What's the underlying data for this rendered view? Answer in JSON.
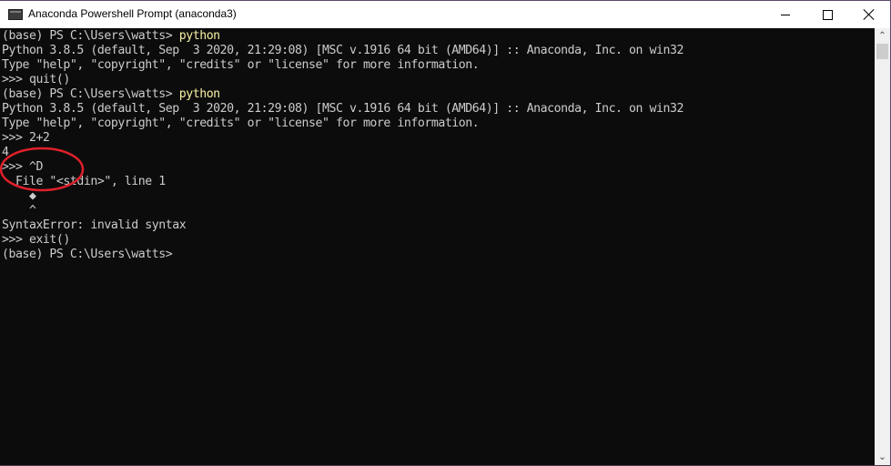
{
  "window": {
    "title": "Anaconda Powershell Prompt (anaconda3)",
    "controls": {
      "minimize": "minimize",
      "maximize": "maximize",
      "close": "close"
    }
  },
  "colors": {
    "terminal_bg": "#0c0c0c",
    "text": "#cccccc",
    "command": "#f9f1a5",
    "annotation": "#e0202a"
  },
  "terminal": {
    "lines": [
      {
        "prefix": "(base) PS C:\\Users\\watts> ",
        "command": "python"
      },
      {
        "text": "Python 3.8.5 (default, Sep  3 2020, 21:29:08) [MSC v.1916 64 bit (AMD64)] :: Anaconda, Inc. on win32"
      },
      {
        "text": "Type \"help\", \"copyright\", \"credits\" or \"license\" for more information."
      },
      {
        "text": ">>> quit()"
      },
      {
        "prefix": "(base) PS C:\\Users\\watts> ",
        "command": "python"
      },
      {
        "text": "Python 3.8.5 (default, Sep  3 2020, 21:29:08) [MSC v.1916 64 bit (AMD64)] :: Anaconda, Inc. on win32"
      },
      {
        "text": "Type \"help\", \"copyright\", \"credits\" or \"license\" for more information."
      },
      {
        "text": ">>> 2+2"
      },
      {
        "text": "4"
      },
      {
        "text": ">>> ^D"
      },
      {
        "text": "  File \"<stdin>\", line 1"
      },
      {
        "text": "    ◆"
      },
      {
        "text": "    ^"
      },
      {
        "text": "SyntaxError: invalid syntax"
      },
      {
        "text": ">>> exit()"
      },
      {
        "text": "(base) PS C:\\Users\\watts>"
      }
    ]
  },
  "scrollbar": {
    "up_glyph": "⌃",
    "down_glyph": "⌄"
  },
  "annotation": {
    "shape": "ellipse",
    "target": ">>> ^D"
  }
}
